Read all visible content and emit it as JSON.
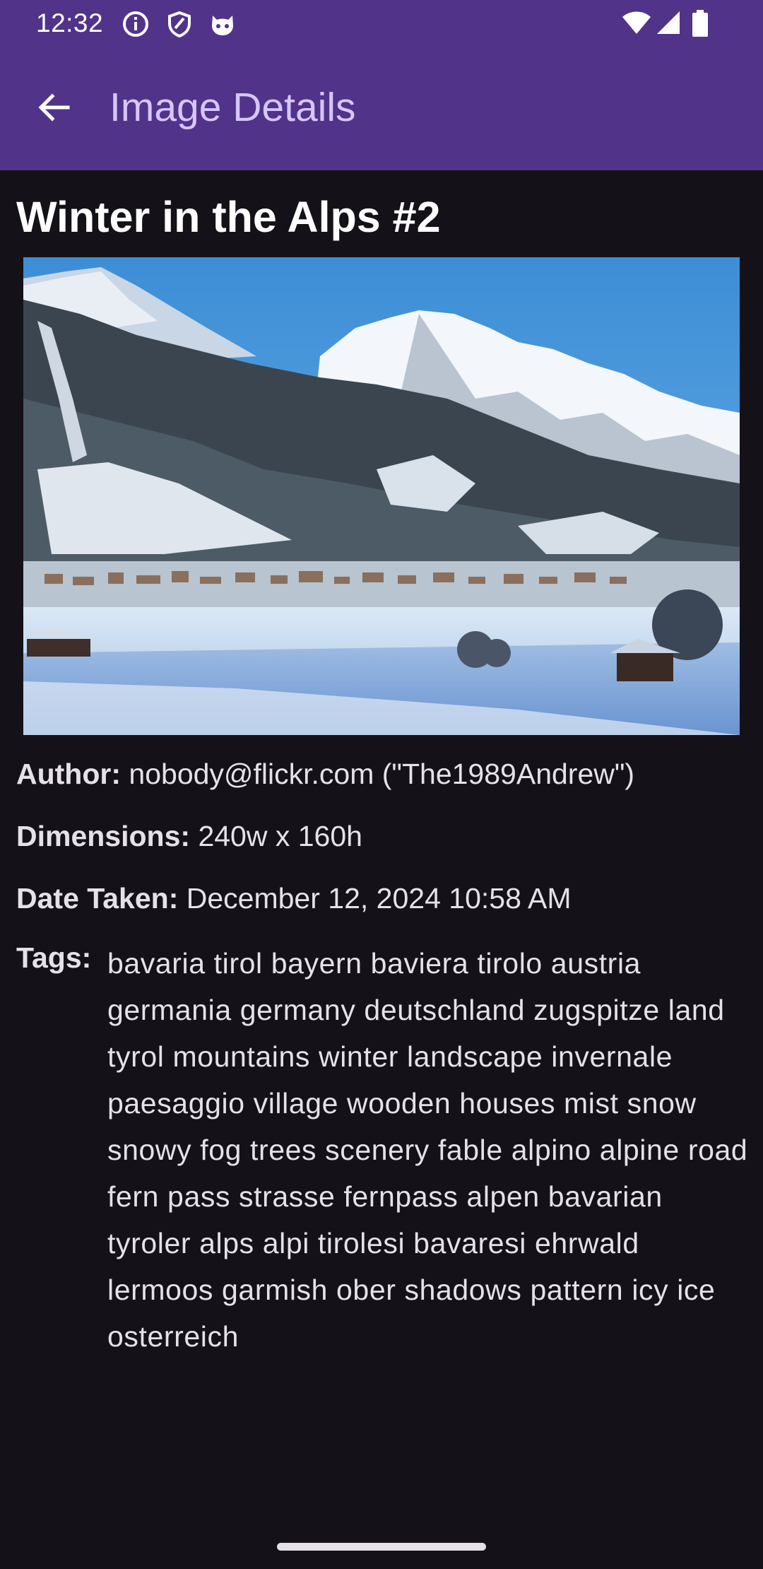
{
  "status_bar": {
    "time": "12:32",
    "left_icons": [
      "info-icon",
      "shield-icon",
      "cat-notification-icon"
    ],
    "right_icons": [
      "wifi-icon",
      "signal-icon",
      "battery-icon"
    ]
  },
  "toolbar": {
    "back_icon": "arrow-back-icon",
    "title": "Image Details"
  },
  "image": {
    "title": "Winter in the Alps #2"
  },
  "details": {
    "author_label": "Author:",
    "author_value": " nobody@flickr.com (\"The1989Andrew\")",
    "dimensions_label": "Dimensions:",
    "dimensions_value": " 240w x 160h",
    "date_label": "Date Taken:",
    "date_value": " December 12, 2024 10:58 AM",
    "tags_label": "Tags:",
    "tags_value": "bavaria tirol bayern baviera tirolo austria germania germany deutschland zugspitze land tyrol mountains winter landscape invernale paesaggio village wooden houses mist snow snowy fog trees scenery fable alpino alpine road fern pass strasse fernpass alpen bavarian tyroler alps alpi tirolesi bavaresi ehrwald lermoos garmish ober shadows pattern icy ice osterreich"
  },
  "colors": {
    "app_bar": "#51338a",
    "background": "#141218",
    "title_text": "#d8c6ff"
  }
}
